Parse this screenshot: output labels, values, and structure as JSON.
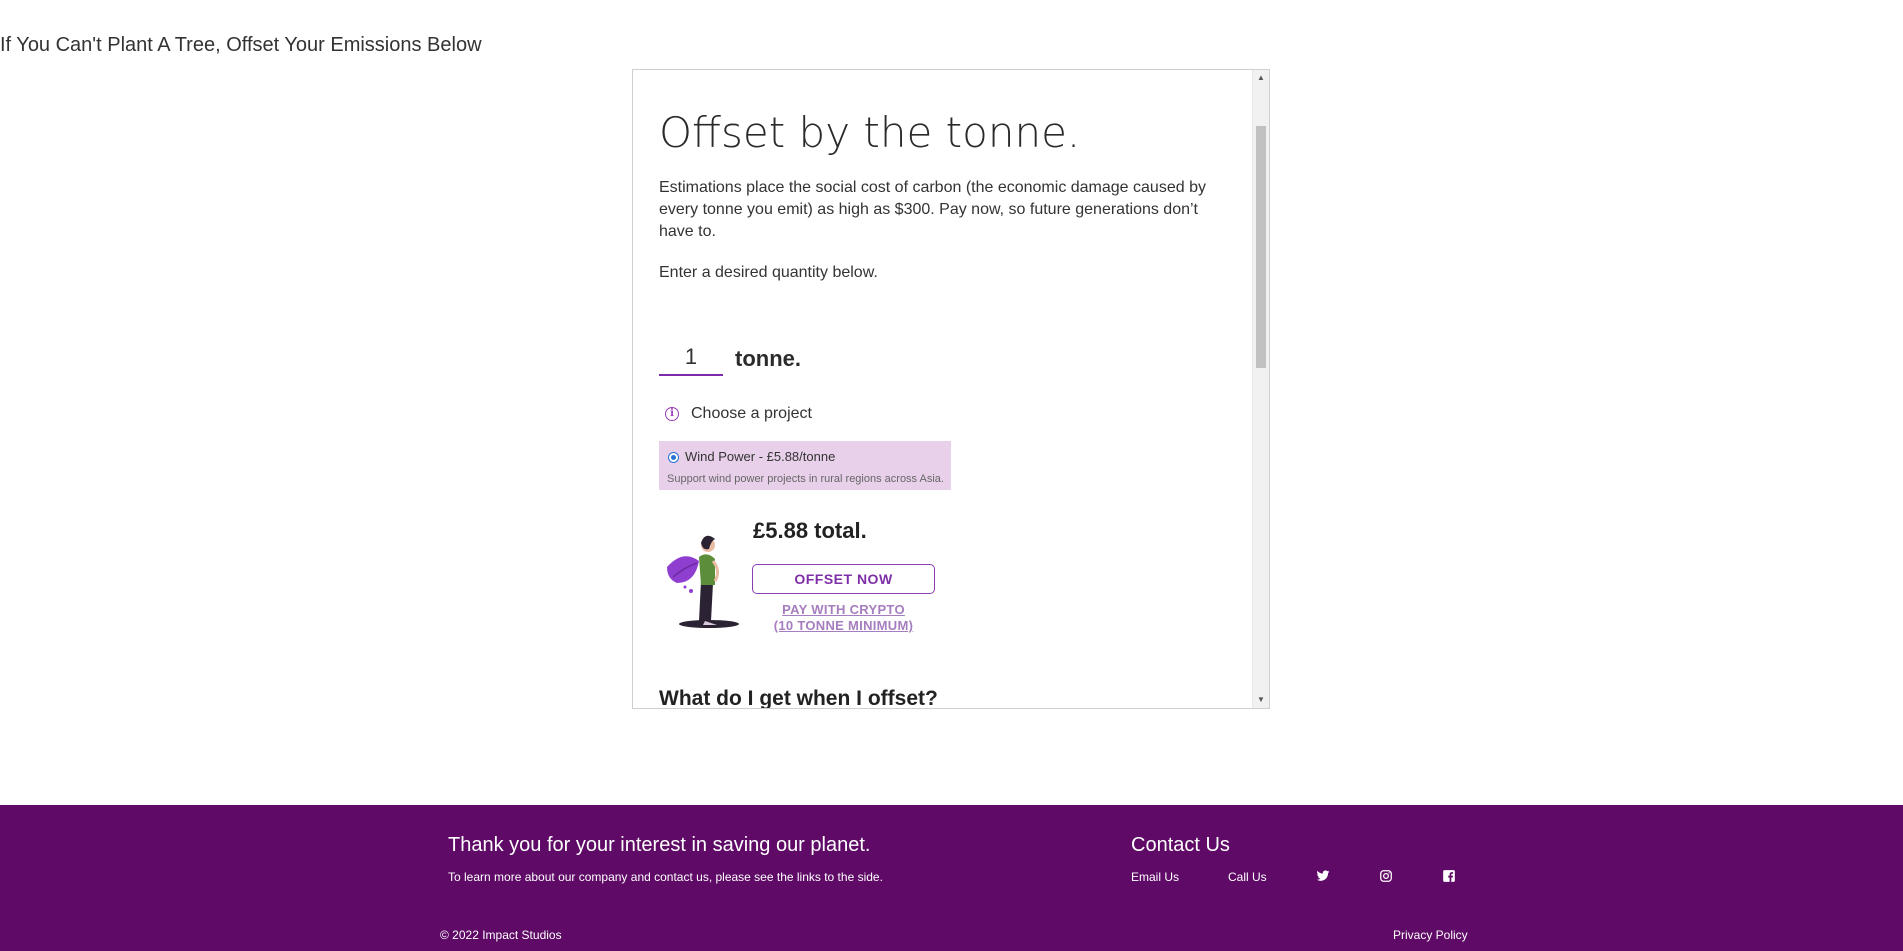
{
  "page": {
    "heading": "If You Can't Plant A Tree, Offset Your Emissions Below"
  },
  "widget": {
    "title": "Offset by the tonne.",
    "description": "Estimations place the social cost of carbon (the economic damage caused by every tonne you emit) as high as $300. Pay now, so future generations don’t have to.",
    "instruction": "Enter a desired quantity below.",
    "quantity_value": "1",
    "quantity_unit": "tonne.",
    "choose_label": "Choose a project",
    "project": {
      "name": "Wind Power - £5.88/tonne",
      "description": "Support wind power projects in rural regions across Asia.",
      "selected": true
    },
    "total": "£5.88 total.",
    "offset_button": "OFFSET NOW",
    "crypto_line1": "PAY WITH CRYPTO",
    "crypto_line2": "(10 TONNE MINIMUM)",
    "faq_heading": "What do I get when I offset?",
    "scroll_up_glyph": "▲",
    "scroll_down_glyph": "▼"
  },
  "footer": {
    "thanks": "Thank you for your interest in saving our planet.",
    "learn_more": "To learn more about our company and contact us, please see the links to the side.",
    "contact_heading": "Contact Us",
    "email_label": "Email Us",
    "call_label": "Call Us",
    "icons": [
      "twitter-icon",
      "instagram-icon",
      "facebook-icon"
    ],
    "copyright": "© 2022 Impact Studios",
    "privacy": "Privacy Policy"
  },
  "colors": {
    "brand_purple": "#5e0a66",
    "accent_purple": "#7d2fa6",
    "project_bg": "#e8d0ea",
    "radio_blue": "#2a72d4"
  }
}
